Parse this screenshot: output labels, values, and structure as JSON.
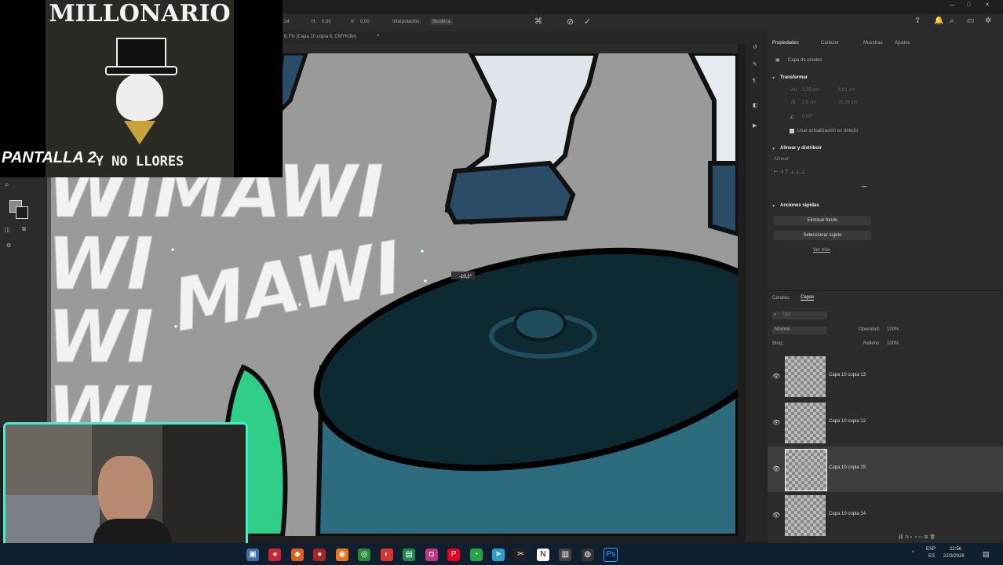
{
  "overlay": {
    "logo_text": "MILLONARIO",
    "logo_sub": "Y NO LLORES",
    "screen_label": "PANTALLA 2"
  },
  "options_bar": {
    "h_label": "H:",
    "h_value": "0,00",
    "v_label": "V:",
    "v_value": "0,00",
    "w_value": "24",
    "interp_label": "Interpolación:",
    "interp_value": "Bicúbica"
  },
  "document_tab": "6,7% (Capa 10 copia 6, CMYK/8#)",
  "canvas": {
    "text_row1": "WIMAWI",
    "text_row2_a": "WI",
    "text_row2_b": "MAWI",
    "text_row3": "WI",
    "text_row4": "WI",
    "rotation_readout": "-10,2°"
  },
  "panel": {
    "tabs": [
      "Propiedades",
      "Carácter",
      "Muestras",
      "Ajustes"
    ],
    "layer_type": "Capa de píxeles",
    "transform_title": "Transformar",
    "an": "An",
    "an_value": "1,35 cm",
    "x_value": "6,61 cm",
    "al": "Al",
    "al_value": "1,8 cm",
    "y_value": "20,25 cm",
    "angle_value": "0,00°",
    "live_update": "Usar actualización en directo",
    "align_title": "Alinear y distribuir",
    "align_sub": "Alinear:",
    "quick_title": "Acciones rápidas",
    "remove_bg": "Eliminar fondo",
    "select_subject": "Seleccionar sujeto",
    "see_more": "Ver más"
  },
  "layers": {
    "tabs": [
      "Canales",
      "Capas"
    ],
    "search_placeholder": "Tipo",
    "blend_mode": "Normal",
    "opacity_label": "Opacidad:",
    "opacity_value": "100%",
    "lock_label": "Bloq.:",
    "fill_label": "Relleno:",
    "fill_value": "100%",
    "items": [
      {
        "name": "Capa 10 copia 13",
        "selected": false
      },
      {
        "name": "Capa 10 copia 12",
        "selected": false
      },
      {
        "name": "Capa 10 copia 15",
        "selected": true
      },
      {
        "name": "Capa 10 copia 14",
        "selected": false
      }
    ]
  },
  "taskbar": {
    "lang": "ESP",
    "region": "ES",
    "time": "22:56",
    "date": "22/3/2026"
  },
  "colors": {
    "accent_teal": "#1f4d5c",
    "pot_dark": "#0d2a33",
    "leaf_green": "#2fcf8a",
    "canvas_bg": "#9a9a9a"
  }
}
